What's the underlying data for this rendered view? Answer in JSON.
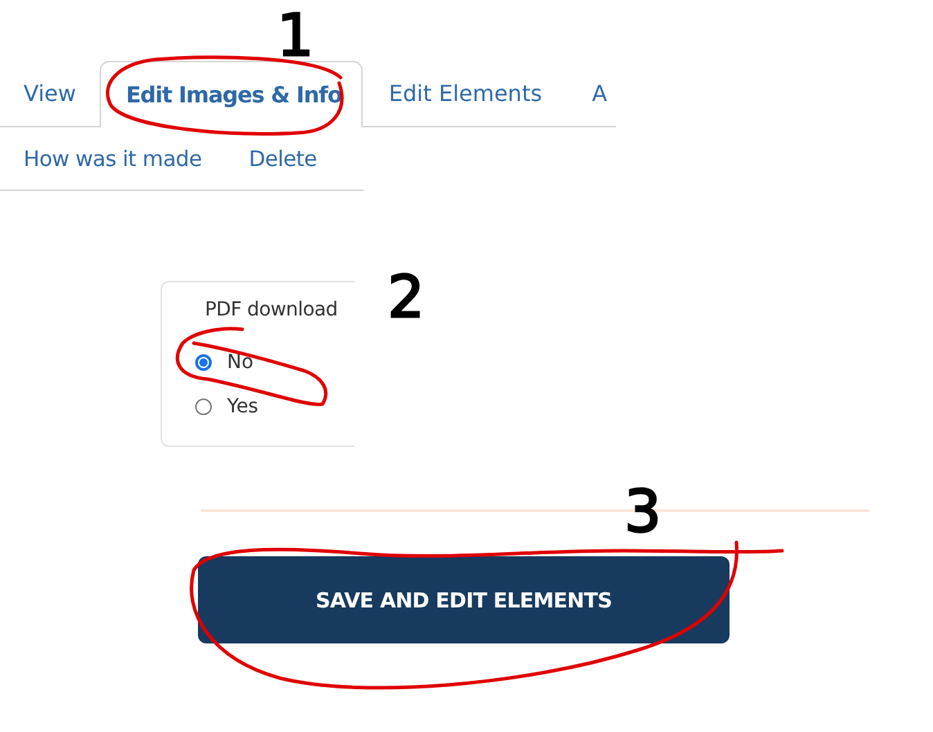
{
  "tabs": [
    {
      "label": "View",
      "selected": false
    },
    {
      "label": "Edit Images & Info",
      "selected": true
    },
    {
      "label": "Edit Elements",
      "selected": false
    },
    {
      "label": "A",
      "selected": false
    }
  ],
  "subtabs": [
    {
      "label": "How was it made"
    },
    {
      "label": "Delete"
    }
  ],
  "pdf_card": {
    "title": "PDF download",
    "options": [
      {
        "label": "No",
        "selected": true
      },
      {
        "label": "Yes",
        "selected": false
      }
    ]
  },
  "save_button": {
    "label": "SAVE AND EDIT ELEMENTS"
  },
  "annotations": [
    {
      "label": "1"
    },
    {
      "label": "2"
    },
    {
      "label": "3"
    }
  ]
}
